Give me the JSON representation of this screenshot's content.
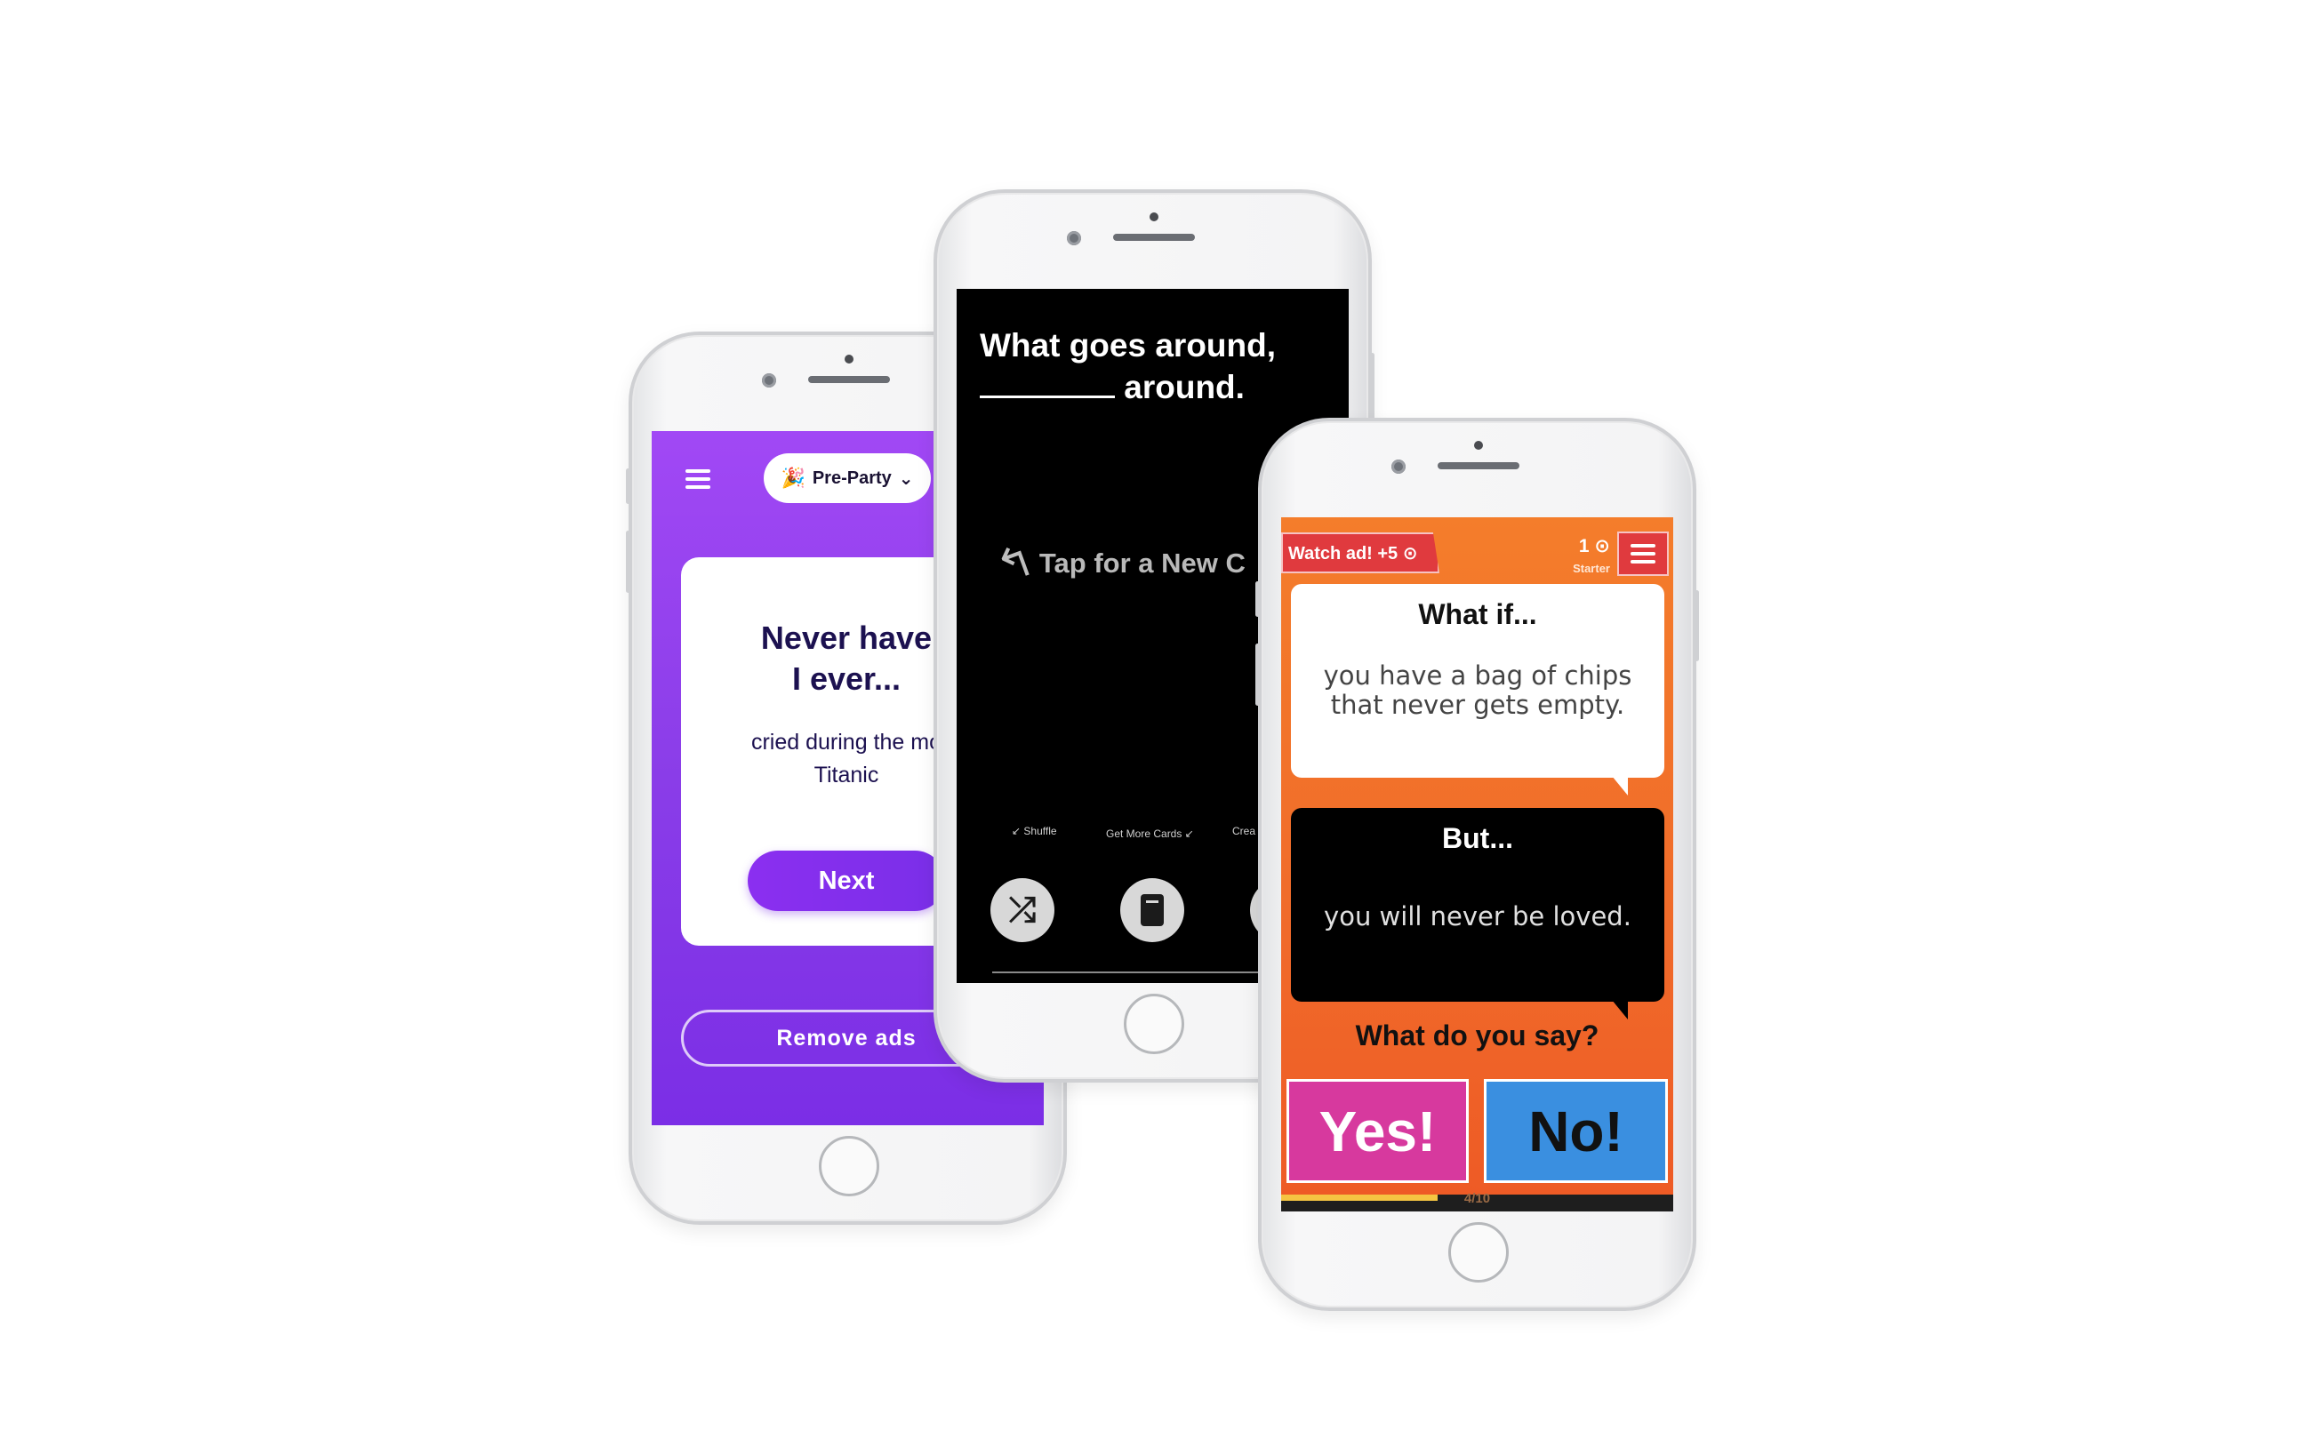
{
  "phone1": {
    "category_label": "Pre-Party",
    "category_emoji": "🎉",
    "prompt_title_line1": "Never have",
    "prompt_title_line2": "I ever...",
    "prompt_text_line1": "cried during the mo",
    "prompt_text_line2": "Titanic",
    "next_label": "Next",
    "remove_ads_label": "Remove ads"
  },
  "phone2": {
    "question_line1": "What goes around,",
    "question_line2_suffix": "around.",
    "tap_hint": "Tap for a New C",
    "shuffle_label": "Shuffle",
    "get_more_label": "Get More Cards",
    "create_label": "Crea"
  },
  "phone3": {
    "watch_ad_label": "Watch ad! +5 ⊙",
    "coins": "1 ⊙",
    "level": "Starter",
    "what_if_title": "What if...",
    "what_if_text": "you have a bag of chips that never gets empty.",
    "but_title": "But...",
    "but_text": "you will never be loved.",
    "question": "What do you say?",
    "yes_label": "Yes!",
    "no_label": "No!",
    "progress_label": "4/10",
    "progress_fraction": 0.4
  }
}
